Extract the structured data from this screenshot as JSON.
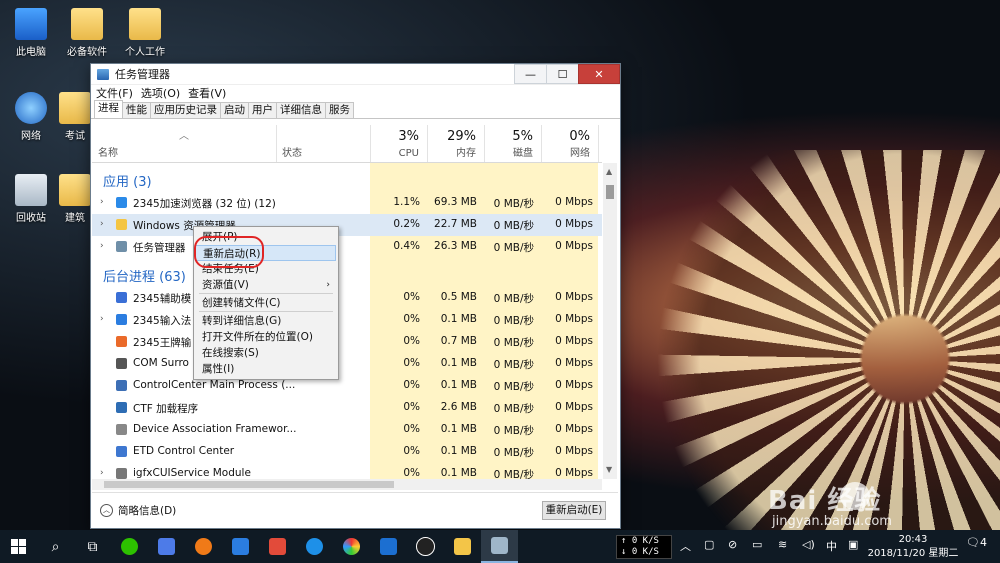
{
  "desktop": {
    "icons": [
      {
        "label": "此电脑",
        "icon": "computer-icon"
      },
      {
        "label": "必备软件",
        "icon": "folder-icon"
      },
      {
        "label": "个人工作",
        "icon": "folder-icon"
      },
      {
        "label": "网络",
        "icon": "network-icon"
      },
      {
        "label": "考试",
        "icon": "folder-icon"
      },
      {
        "label": "回收站",
        "icon": "recycle-bin-icon"
      },
      {
        "label": "建筑",
        "icon": "folder-icon"
      }
    ]
  },
  "window": {
    "title": "任务管理器",
    "controls": {
      "minimize": "—",
      "maximize": "☐",
      "close": "✕"
    },
    "menu": [
      "文件(F)",
      "选项(O)",
      "查看(V)"
    ],
    "tabs": [
      "进程",
      "性能",
      "应用历史记录",
      "启动",
      "用户",
      "详细信息",
      "服务"
    ],
    "active_tab": "进程"
  },
  "columns": {
    "name": "名称",
    "status": "状态",
    "cpu": {
      "pct": "3%",
      "label": "CPU"
    },
    "memory": {
      "pct": "29%",
      "label": "内存"
    },
    "disk": {
      "pct": "5%",
      "label": "磁盘"
    },
    "network": {
      "pct": "0%",
      "label": "网络"
    }
  },
  "groups": {
    "apps": "应用 (3)",
    "background": "后台进程 (63)"
  },
  "apps": [
    {
      "name": "2345加速浏览器 (32 位) (12)",
      "cpu": "1.1%",
      "mem": "69.3 MB",
      "disk": "0 MB/秒",
      "net": "0 Mbps",
      "expand": "›"
    },
    {
      "name": "Windows 资源管理器",
      "cpu": "0.2%",
      "mem": "22.7 MB",
      "disk": "0 MB/秒",
      "net": "0 Mbps",
      "expand": "›"
    },
    {
      "name": "任务管理器",
      "cpu": "0.4%",
      "mem": "26.3 MB",
      "disk": "0 MB/秒",
      "net": "0 Mbps",
      "expand": "›"
    }
  ],
  "background": [
    {
      "name": "2345辅助模",
      "cpu": "0%",
      "mem": "0.5 MB",
      "disk": "0 MB/秒",
      "net": "0 Mbps",
      "expand": ""
    },
    {
      "name": "2345输入法",
      "cpu": "0%",
      "mem": "0.1 MB",
      "disk": "0 MB/秒",
      "net": "0 Mbps",
      "expand": "›"
    },
    {
      "name": "2345王牌输",
      "cpu": "0%",
      "mem": "0.7 MB",
      "disk": "0 MB/秒",
      "net": "0 Mbps",
      "expand": ""
    },
    {
      "name": "COM Surro",
      "cpu": "0%",
      "mem": "0.1 MB",
      "disk": "0 MB/秒",
      "net": "0 Mbps",
      "expand": ""
    },
    {
      "name": "ControlCenter Main Process (...",
      "cpu": "0%",
      "mem": "0.1 MB",
      "disk": "0 MB/秒",
      "net": "0 Mbps",
      "expand": ""
    },
    {
      "name": "CTF 加载程序",
      "cpu": "0%",
      "mem": "2.6 MB",
      "disk": "0 MB/秒",
      "net": "0 Mbps",
      "expand": ""
    },
    {
      "name": "Device Association Framewor...",
      "cpu": "0%",
      "mem": "0.1 MB",
      "disk": "0 MB/秒",
      "net": "0 Mbps",
      "expand": ""
    },
    {
      "name": "ETD Control Center",
      "cpu": "0%",
      "mem": "0.1 MB",
      "disk": "0 MB/秒",
      "net": "0 Mbps",
      "expand": ""
    },
    {
      "name": "igfxCUIService Module",
      "cpu": "0%",
      "mem": "0.1 MB",
      "disk": "0 MB/秒",
      "net": "0 Mbps",
      "expand": "›"
    }
  ],
  "context_menu": [
    {
      "label": "展开(P)",
      "submenu": false
    },
    {
      "label": "重新启动(R)",
      "submenu": false,
      "highlight": true
    },
    {
      "label": "结束任务(E)",
      "submenu": false
    },
    {
      "label": "资源值(V)",
      "submenu": true
    },
    {
      "label": "创建转储文件(C)",
      "submenu": false
    },
    {
      "label": "转到详细信息(G)",
      "submenu": false
    },
    {
      "label": "打开文件所在的位置(O)",
      "submenu": false
    },
    {
      "label": "在线搜索(S)",
      "submenu": false
    },
    {
      "label": "属性(I)",
      "submenu": false
    }
  ],
  "footer": {
    "fewer_details": "简略信息(D)",
    "restart_button": "重新启动(E)"
  },
  "watermark": {
    "brand": "Bai  经验",
    "url": "jingyan.baidu.com"
  },
  "taskbar": {
    "net_up": "0 K/S",
    "net_down": "0 K/S",
    "ime": "中",
    "time": "20:43",
    "date": "2018/11/20 星期二",
    "notifications": "4"
  },
  "colors": {
    "accent": "#2467c4",
    "heat": "#fff4c6",
    "selected_row": "#dce8f5",
    "annotation": "#e02525"
  }
}
